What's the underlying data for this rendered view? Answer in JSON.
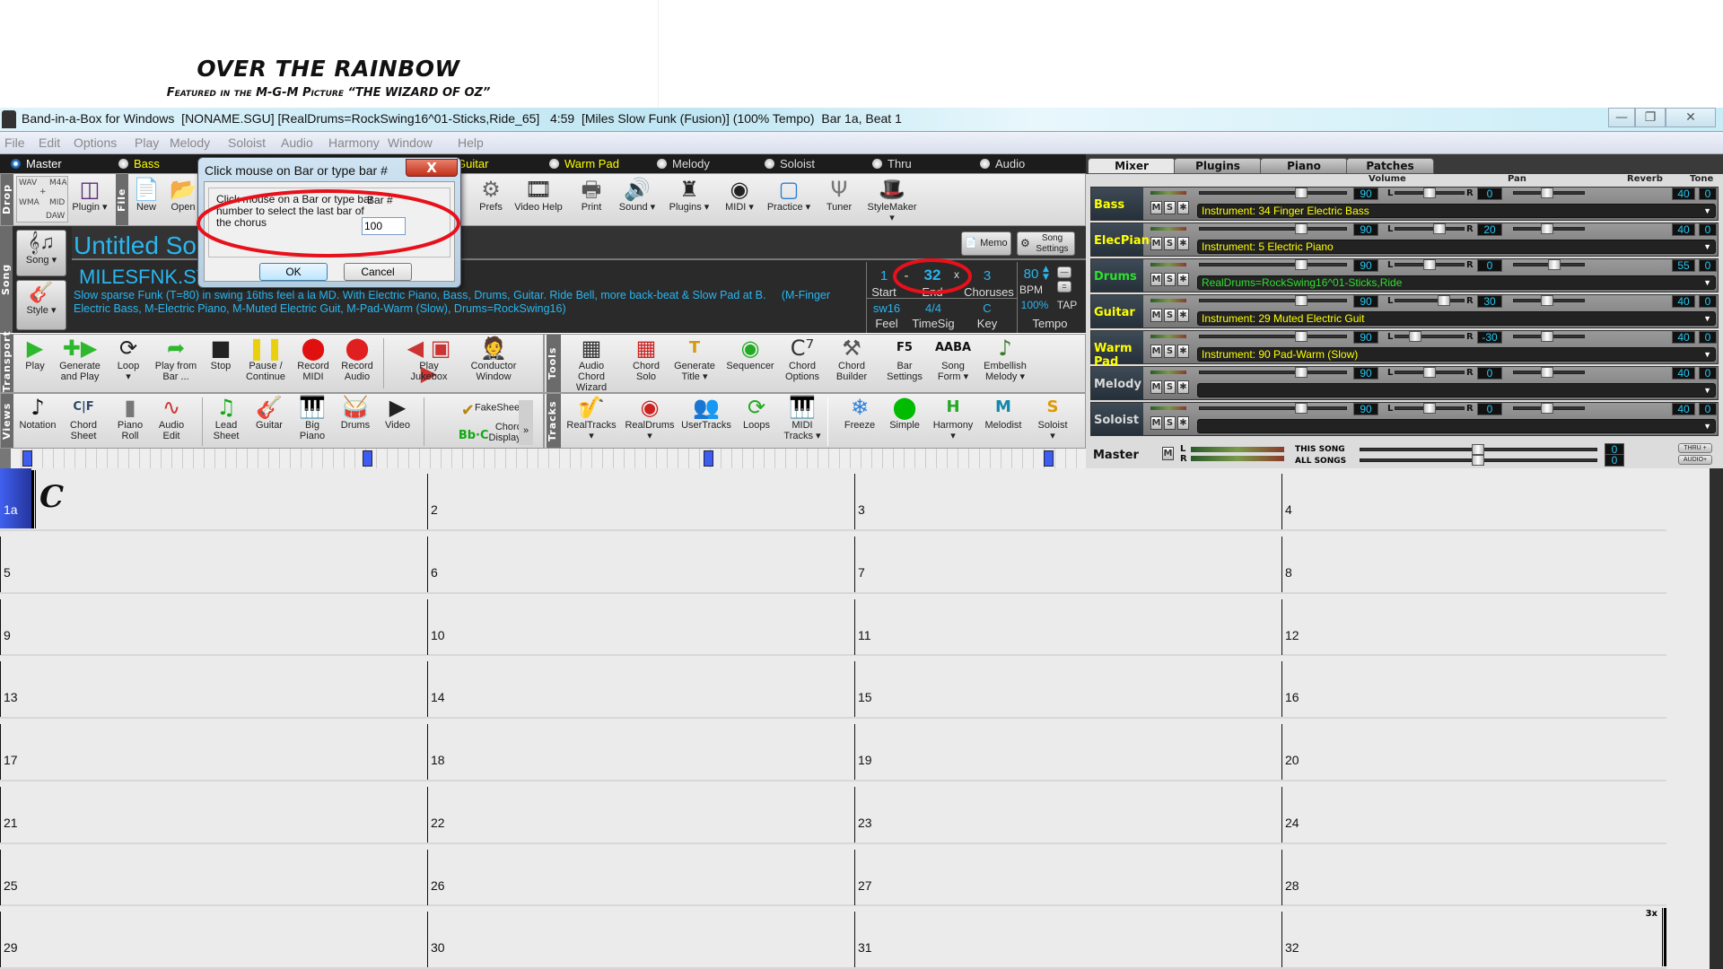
{
  "sheet": {
    "title": "OVER THE RAINBOW",
    "subtitle": "Featured in the M-G-M Picture “THE WIZARD OF OZ”"
  },
  "window": {
    "title": "Band-in-a-Box for Windows  [NONAME.SGU] [RealDrums=RockSwing16^01-Sticks,Ride_65]   4:59  [Miles Slow Funk (Fusion)] (100% Tempo)  Bar 1a, Beat 1"
  },
  "menu": [
    "File",
    "Edit",
    "Options",
    "Play",
    "Melody",
    "Soloist",
    "Audio",
    "Harmony",
    "Window",
    "Help"
  ],
  "tracks_radio": [
    {
      "label": "Master",
      "selected": true,
      "color": "#ffffff"
    },
    {
      "label": "Bass",
      "selected": false,
      "color": "#ffff00"
    },
    {
      "label": "ElecPiano",
      "selected": false,
      "color": "#ffff00"
    },
    {
      "label": "Drums",
      "selected": false,
      "color": "#2ee02e"
    },
    {
      "label": "Guitar",
      "selected": false,
      "color": "#ffff00"
    },
    {
      "label": "Warm Pad",
      "selected": false,
      "color": "#ffff00"
    },
    {
      "label": "Melody",
      "selected": false,
      "color": "#dddddd"
    },
    {
      "label": "Soloist",
      "selected": false,
      "color": "#dddddd"
    },
    {
      "label": "Thru",
      "selected": false,
      "color": "#dddddd"
    },
    {
      "label": "Audio",
      "selected": false,
      "color": "#dddddd"
    }
  ],
  "side_labels": {
    "drop": "Drop",
    "file": "File",
    "song": "Song",
    "transport": "Transport",
    "views": "Views",
    "tools": "Tools",
    "tracks": "Tracks"
  },
  "drop_zone": {
    "wav": "WAV",
    "m4a": "M4A",
    "wma": "WMA",
    "mid": "MID",
    "plus": "+",
    "daw": "DAW"
  },
  "file_toolbar": [
    {
      "label": "Plugin ▾",
      "icon": "daw-plugin"
    },
    {
      "label": "New",
      "icon": "new-file"
    },
    {
      "label": "Open",
      "icon": "open-folder"
    },
    {
      "label": "Prefs",
      "icon": "gear"
    },
    {
      "label": "Video Help",
      "icon": "film"
    },
    {
      "label": "Print",
      "icon": "printer"
    },
    {
      "label": "Sound ▾",
      "icon": "speaker"
    },
    {
      "label": "Plugins ▾",
      "icon": "vst-plugin"
    },
    {
      "label": "MIDI ▾",
      "icon": "midi-connector"
    },
    {
      "label": "Practice ▾",
      "icon": "practice"
    },
    {
      "label": "Tuner",
      "icon": "tuning-fork"
    },
    {
      "label": "StyleMaker ▾",
      "icon": "style-hat"
    }
  ],
  "song_buttons": {
    "song": "Song ▾",
    "style": "Style ▾"
  },
  "song": {
    "title": "Untitled Son",
    "style": "MILESFNK.STY",
    "description": "Slow sparse Funk (T=80) in swing 16ths feel a la MD. With Electric Piano, Bass, Drums, Guitar. Ride Bell, more back-beat & Slow Pad at B.     (M-Finger Electric Bass, M-Electric Piano, M-Muted Electric Guit, M-Pad-Warm (Slow), Drums=RockSwing16)",
    "memo": "Memo",
    "song_settings": "Song\nSettings",
    "start": "1",
    "start_label": "Start",
    "dash": "-",
    "end": "32",
    "end_label": "End",
    "times": "x",
    "choruses": "3",
    "choruses_label": "Choruses",
    "feel": "sw16",
    "feel_label": "Feel",
    "timesig": "4/4",
    "timesig_label": "TimeSig",
    "key": "C",
    "key_label": "Key",
    "bpm": "80",
    "bpm_label": "BPM",
    "tempo_pct": "100%",
    "tap": "TAP",
    "tempo_label": "Tempo"
  },
  "transport": [
    {
      "label": "Play",
      "icon": "play"
    },
    {
      "label": "Generate\nand Play",
      "icon": "generate-play"
    },
    {
      "label": "Loop\n▾",
      "icon": "loop"
    },
    {
      "label": "Play from\nBar ...",
      "icon": "play-from-bar"
    },
    {
      "label": "Stop",
      "icon": "stop"
    },
    {
      "label": "Pause /\nContinue",
      "icon": "pause"
    },
    {
      "label": "Record\nMIDI",
      "icon": "record"
    },
    {
      "label": "Record\nAudio",
      "icon": "record-audio"
    },
    {
      "label": "Play\nJukebox",
      "icon": "jukebox"
    },
    {
      "label": "Conductor\nWindow",
      "icon": "conductor"
    }
  ],
  "tools": [
    {
      "label": "Audio Chord\nWizard",
      "icon": "audio-chord-wizard"
    },
    {
      "label": "Chord\nSolo",
      "icon": "chord-solo"
    },
    {
      "label": "Generate\nTitle ▾",
      "icon": "generate-title"
    },
    {
      "label": "Sequencer",
      "icon": "sequencer"
    },
    {
      "label": "Chord\nOptions",
      "icon": "chord-options"
    },
    {
      "label": "Chord\nBuilder",
      "icon": "chord-builder"
    },
    {
      "label": "Bar\nSettings",
      "icon": "bar-settings"
    },
    {
      "label": "Song\nForm ▾",
      "icon": "song-form"
    },
    {
      "label": "Embellish\nMelody ▾",
      "icon": "embellish-melody"
    }
  ],
  "views": [
    {
      "label": "Notation",
      "icon": "note"
    },
    {
      "label": "Chord\nSheet",
      "icon": "chord-sheet"
    },
    {
      "label": "Piano\nRoll",
      "icon": "piano-roll"
    },
    {
      "label": "Audio\nEdit",
      "icon": "audio-edit"
    },
    {
      "label": "Lead\nSheet",
      "icon": "lead-sheet"
    },
    {
      "label": "Guitar",
      "icon": "guitar"
    },
    {
      "label": "Big\nPiano",
      "icon": "piano"
    },
    {
      "label": "Drums",
      "icon": "drum"
    },
    {
      "label": "Video",
      "icon": "video"
    },
    {
      "label": "FakeSheet",
      "icon": "fakesheet"
    },
    {
      "label": "Chord\nDisplay ▾",
      "icon": "chord-display"
    },
    {
      "label": "»",
      "icon": "more"
    }
  ],
  "tracks_tb": [
    {
      "label": "RealTracks\n▾",
      "icon": "realtracks"
    },
    {
      "label": "RealDrums\n▾",
      "icon": "realdrums"
    },
    {
      "label": "UserTracks",
      "icon": "usertracks"
    },
    {
      "label": "Loops",
      "icon": "loops"
    },
    {
      "label": "MIDI\nTracks ▾",
      "icon": "midi-tracks"
    },
    {
      "label": "Freeze",
      "icon": "snowflake"
    },
    {
      "label": "Simple",
      "icon": "green-circle"
    },
    {
      "label": "Harmony\n▾",
      "icon": "harmony"
    },
    {
      "label": "Melodist",
      "icon": "melodist"
    },
    {
      "label": "Soloist\n▾",
      "icon": "soloist"
    }
  ],
  "dialog": {
    "title": "Click mouse on Bar or type bar #",
    "close": "X",
    "message": "Click mouse on a Bar or type bar number to select the last bar of the chorus",
    "bar_label": "Bar #",
    "value": "100",
    "ok": "OK",
    "cancel": "Cancel"
  },
  "mixer": {
    "tabs": [
      {
        "label": "Mixer",
        "active": true
      },
      {
        "label": "Plugins"
      },
      {
        "label": "Piano"
      },
      {
        "label": "Patches"
      }
    ],
    "headers": {
      "volume": "Volume",
      "pan": "Pan",
      "reverb": "Reverb",
      "tone": "Tone"
    },
    "buttons": {
      "mute": "M",
      "solo": "S",
      "fx": "✱",
      "left": "L",
      "right": "R"
    },
    "channels": [
      {
        "name": "Bass",
        "name_color": "#ffff00",
        "volume": "90",
        "pan": "0",
        "reverb": "40",
        "tone": "0",
        "instrument": "Instrument: 34 Finger Electric Bass",
        "inst_color": "#ffff00"
      },
      {
        "name": "ElecPiano",
        "name_color": "#ffff00",
        "volume": "90",
        "pan": "20",
        "reverb": "40",
        "tone": "0",
        "instrument": "Instrument: 5 Electric Piano",
        "inst_color": "#ffff00"
      },
      {
        "name": "Drums",
        "name_color": "#2ee02e",
        "volume": "90",
        "pan": "0",
        "reverb": "55",
        "tone": "0",
        "instrument": "RealDrums=RockSwing16^01-Sticks,Ride",
        "inst_color": "#2ee02e"
      },
      {
        "name": "Guitar",
        "name_color": "#ffff00",
        "volume": "90",
        "pan": "30",
        "reverb": "40",
        "tone": "0",
        "instrument": "Instrument: 29 Muted Electric Guit",
        "inst_color": "#ffff00"
      },
      {
        "name": "Warm Pad",
        "name_color": "#ffff00",
        "volume": "90",
        "pan": "-30",
        "reverb": "40",
        "tone": "0",
        "instrument": "Instrument: 90 Pad-Warm (Slow)",
        "inst_color": "#ffff00"
      },
      {
        "name": "Melody",
        "name_color": "#d8d8d8",
        "volume": "90",
        "pan": "0",
        "reverb": "40",
        "tone": "0",
        "instrument": "",
        "inst_color": "#ffffff"
      },
      {
        "name": "Soloist",
        "name_color": "#d8d8d8",
        "volume": "90",
        "pan": "0",
        "reverb": "40",
        "tone": "0",
        "instrument": "",
        "inst_color": "#ffffff"
      }
    ],
    "master": {
      "label": "Master",
      "this_song": "THIS SONG",
      "this_song_value": "0",
      "all_songs": "ALL SONGS",
      "all_songs_value": "0",
      "thru": "THRU +",
      "audio": "AUDIO+"
    }
  },
  "chord_sheet": {
    "bars": [
      "1a",
      "2",
      "3",
      "4",
      "5",
      "6",
      "7",
      "8",
      "9",
      "10",
      "11",
      "12",
      "13",
      "14",
      "15",
      "16",
      "17",
      "18",
      "19",
      "20",
      "21",
      "22",
      "23",
      "24",
      "25",
      "26",
      "27",
      "28",
      "29",
      "30",
      "31",
      "32"
    ],
    "first_chord": "C",
    "repeat": "3x",
    "current_bar": "1a"
  },
  "colors": {
    "accent": "#29b6f0",
    "highlight": "#3d5cf0",
    "annotation": "#e8101a"
  }
}
